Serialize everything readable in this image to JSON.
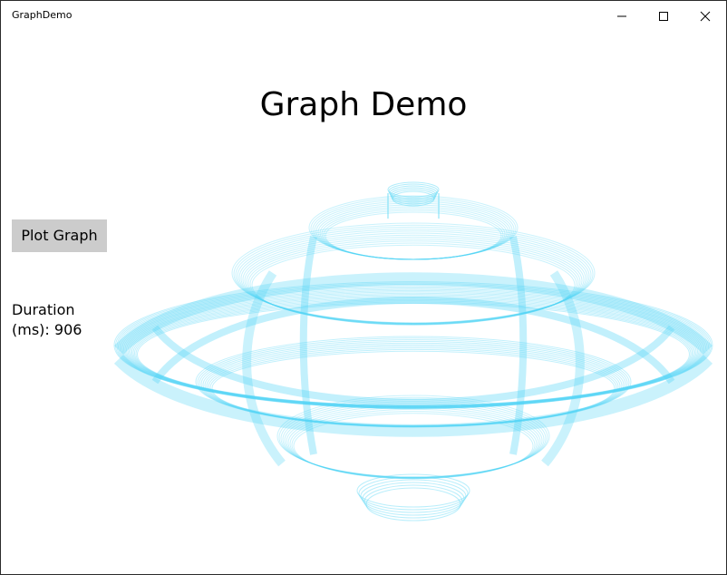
{
  "window": {
    "title": "GraphDemo"
  },
  "page": {
    "heading": "Graph Demo",
    "plot_button_label": "Plot Graph",
    "duration_label": "Duration",
    "duration_value_text": "(ms): 906"
  },
  "graph": {
    "color": "#4fd5f5"
  },
  "icons": [
    "minimize-icon",
    "maximize-icon",
    "close-icon"
  ]
}
